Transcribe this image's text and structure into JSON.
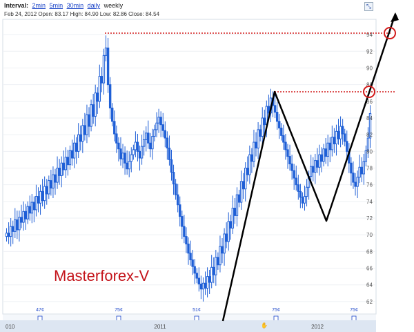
{
  "header": {
    "interval_label": "Interval:",
    "intervals": [
      "2min",
      "5min",
      "30min",
      "daily",
      "weekly"
    ],
    "selected_interval": "weekly",
    "ohlc_text": "Feb 24, 2012 Open: 83.17 High: 84.90 Low: 82.86 Close: 84.54"
  },
  "watermark": "Masterforex-V",
  "chart_data": {
    "type": "candlestick",
    "title": "",
    "xlabel": "",
    "ylabel": "",
    "ylim": [
      60.5,
      95.5
    ],
    "y_ticks": [
      62,
      64,
      66,
      68,
      70,
      72,
      74,
      76,
      78,
      80,
      82,
      84,
      86,
      88,
      90,
      92,
      94
    ],
    "x_tick_labels": [
      "010",
      "2011",
      "2012"
    ],
    "dividends": [
      "47¢",
      "75¢",
      "51¢",
      "75¢",
      "75¢"
    ],
    "candle_color": "#1f5fd6",
    "series": [
      {
        "name": "price",
        "close": [
          70.2,
          69.8,
          71.0,
          70.4,
          71.8,
          70.6,
          72.1,
          71.5,
          72.8,
          71.9,
          73.4,
          72.6,
          73.9,
          73.0,
          74.6,
          73.8,
          75.2,
          74.1,
          75.8,
          74.9,
          76.5,
          75.6,
          77.2,
          76.3,
          78.0,
          77.1,
          78.6,
          77.8,
          79.3,
          78.4,
          80.1,
          79.2,
          81.0,
          80.0,
          82.0,
          81.2,
          83.1,
          82.0,
          84.4,
          83.0,
          85.6,
          84.2,
          87.0,
          86.0,
          89.0,
          88.2,
          91.5,
          92.4,
          88.0,
          85.2,
          83.6,
          82.1,
          81.0,
          80.3,
          79.1,
          79.8,
          78.6,
          77.9,
          78.8,
          79.6,
          80.2,
          81.1,
          80.0,
          79.2,
          80.6,
          81.4,
          82.2,
          81.0,
          80.3,
          81.8,
          82.6,
          83.4,
          84.1,
          83.2,
          82.5,
          81.6,
          80.4,
          79.0,
          77.5,
          76.1,
          74.8,
          73.6,
          72.2,
          71.0,
          69.8,
          68.9,
          67.8,
          67.0,
          66.2,
          65.4,
          64.8,
          64.1,
          63.5,
          64.2,
          63.6,
          65.0,
          64.3,
          66.1,
          65.2,
          67.3,
          66.4,
          68.6,
          67.8,
          70.1,
          69.2,
          71.6,
          70.8,
          73.2,
          72.3,
          74.8,
          73.9,
          76.4,
          75.5,
          78.0,
          77.2,
          79.6,
          78.8,
          81.1,
          80.4,
          82.6,
          81.8,
          84.0,
          83.2,
          85.4,
          84.6,
          86.4,
          85.5,
          84.7,
          83.6,
          82.8,
          81.9,
          81.1,
          80.2,
          79.4,
          78.5,
          77.7,
          76.8,
          76.0,
          75.2,
          74.5,
          73.8,
          74.6,
          75.7,
          77.0,
          78.2,
          77.5,
          78.9,
          78.1,
          79.6,
          78.8,
          80.3,
          79.4,
          81.0,
          80.2,
          81.7,
          80.9,
          82.4,
          81.5,
          83.0,
          82.1,
          81.2,
          80.0,
          78.6,
          77.4,
          76.3,
          75.8,
          76.9,
          78.1,
          77.3,
          78.8,
          80.1,
          81.6,
          84.54
        ]
      }
    ]
  }
}
